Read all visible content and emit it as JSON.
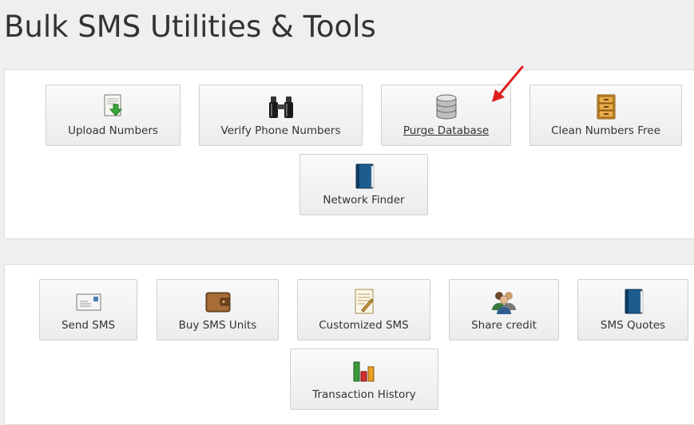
{
  "page": {
    "title": "Bulk SMS Utilities & Tools"
  },
  "utilities": [
    {
      "label": "Upload Numbers",
      "icon": "upload-document-icon"
    },
    {
      "label": "Verify Phone Numbers",
      "icon": "binoculars-icon"
    },
    {
      "label": "Purge Database",
      "icon": "database-icon",
      "hovered": true
    },
    {
      "label": "Clean Numbers Free",
      "icon": "filing-cabinet-icon"
    },
    {
      "label": "Network Finder",
      "icon": "blue-book-icon"
    }
  ],
  "tools": [
    {
      "label": "Send SMS",
      "icon": "envelope-icon"
    },
    {
      "label": "Buy SMS Units",
      "icon": "wallet-icon"
    },
    {
      "label": "Customized SMS",
      "icon": "edit-document-icon"
    },
    {
      "label": "Share credit",
      "icon": "users-icon"
    },
    {
      "label": "SMS Quotes",
      "icon": "blue-book-icon"
    },
    {
      "label": "Transaction History",
      "icon": "bar-chart-icon"
    }
  ],
  "colors": {
    "annotation_arrow": "#e02020",
    "background": "#efefef"
  }
}
